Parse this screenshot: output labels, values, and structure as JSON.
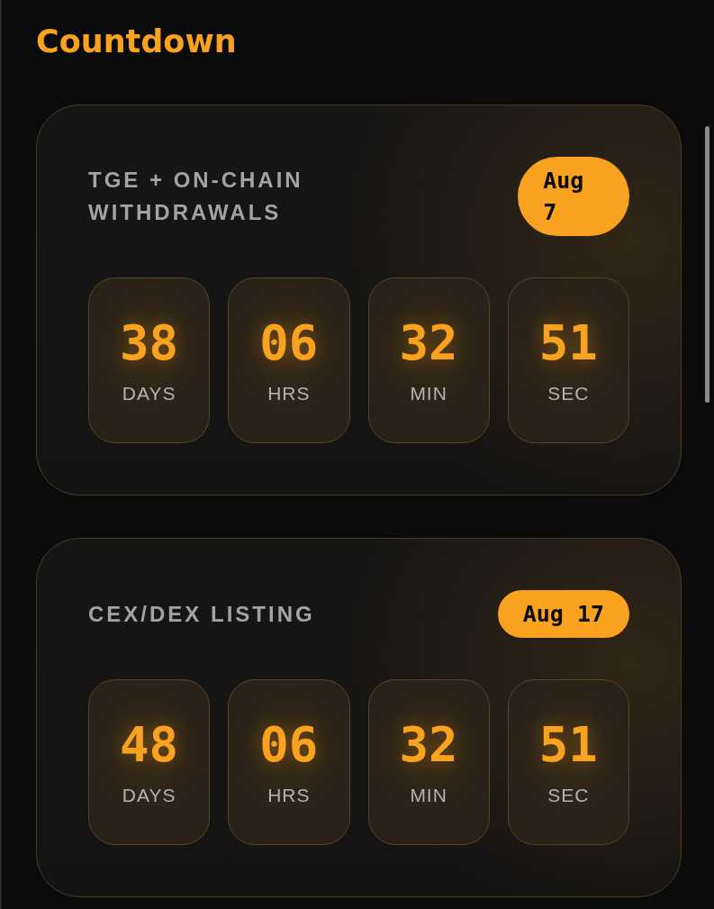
{
  "title": "Countdown",
  "events": [
    {
      "name": "TGE + ON-CHAIN WITHDRAWALS",
      "date": "Aug 7",
      "units": [
        {
          "value": "38",
          "label": "DAYS"
        },
        {
          "value": "06",
          "label": "HRS"
        },
        {
          "value": "32",
          "label": "MIN"
        },
        {
          "value": "51",
          "label": "SEC"
        }
      ]
    },
    {
      "name": "CEX/DEX LISTING",
      "date": "Aug 17",
      "units": [
        {
          "value": "48",
          "label": "DAYS"
        },
        {
          "value": "06",
          "label": "HRS"
        },
        {
          "value": "32",
          "label": "MIN"
        },
        {
          "value": "51",
          "label": "SEC"
        }
      ]
    }
  ]
}
